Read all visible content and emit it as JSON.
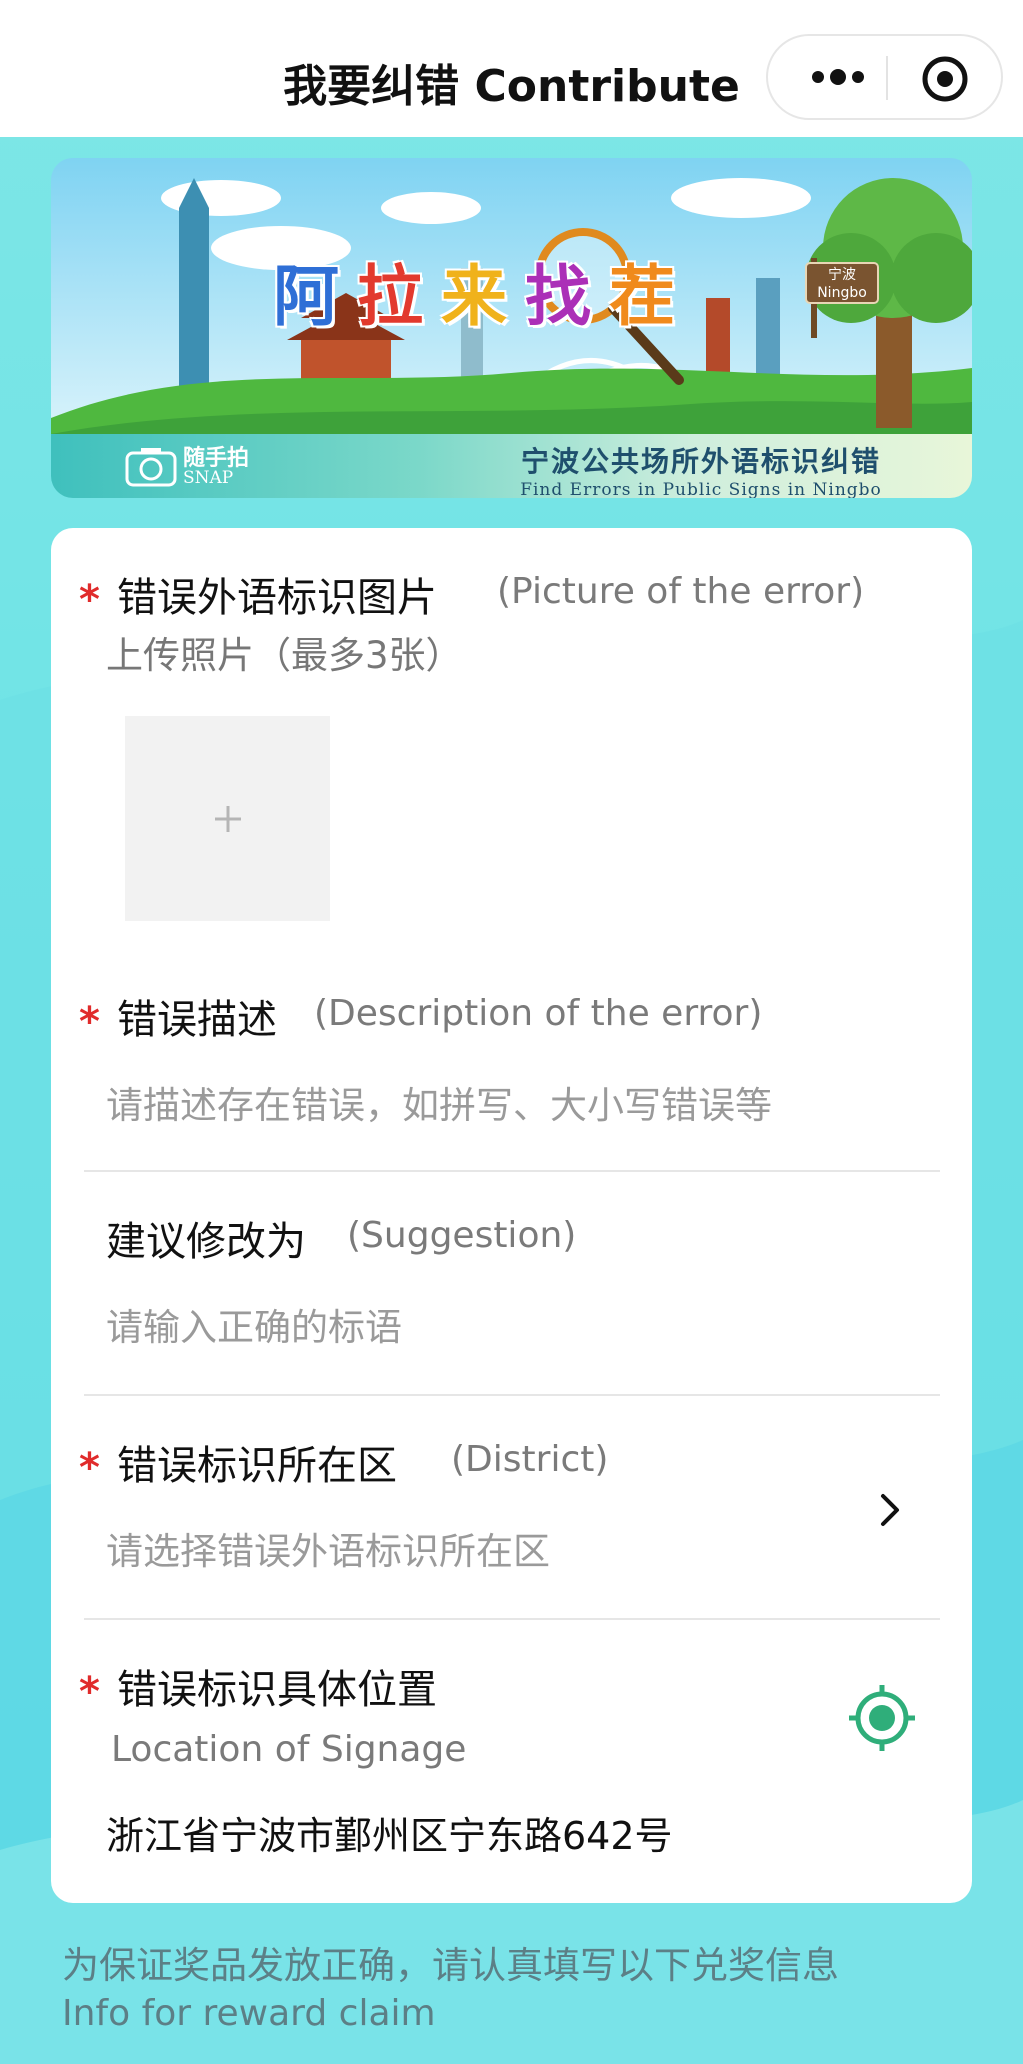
{
  "header": {
    "title": "我要纠错 Contribute",
    "more_icon": "more-dots-icon",
    "close_icon": "target-circle-icon"
  },
  "banner": {
    "title_chars": [
      "阿",
      "拉",
      "来",
      "找",
      "茬"
    ],
    "title_colors": [
      "#2f6fd6",
      "#e23a2e",
      "#f0b21b",
      "#ab2fb7",
      "#f08a1c"
    ],
    "sign_cn": "宁波",
    "sign_en": "Ningbo",
    "snap_cn": "随手拍",
    "snap_en": "SNAP",
    "subtitle_cn": "宁波公共场所外语标识纠错",
    "subtitle_en": "Find Errors in Public Signs in Ningbo"
  },
  "form": {
    "picture": {
      "label_cn": "错误外语标识图片",
      "label_en": "(Picture of the error)",
      "hint": "上传照片（最多3张）",
      "upload_icon": "plus-icon"
    },
    "description": {
      "label_cn": "错误描述",
      "label_en": "(Description of the error)",
      "placeholder": "请描述存在错误，如拼写、大小写错误等"
    },
    "suggestion": {
      "label_cn": "建议修改为",
      "label_en": "(Suggestion)",
      "placeholder": "请输入正确的标语"
    },
    "district": {
      "label_cn": "错误标识所在区",
      "label_en": "(District)",
      "placeholder": "请选择错误外语标识所在区",
      "icon": "chevron-right-icon"
    },
    "location": {
      "label_cn": "错误标识具体位置",
      "label_en": "Location of Signage",
      "value": "浙江省宁波市鄞州区宁东路642号",
      "icon": "locate-icon",
      "icon_color": "#2fae7a"
    },
    "required_mark": "*"
  },
  "footer": {
    "note_cn": "为保证奖品发放正确，请认真填写以下兑奖信息",
    "note_en": "Info for reward claim"
  }
}
